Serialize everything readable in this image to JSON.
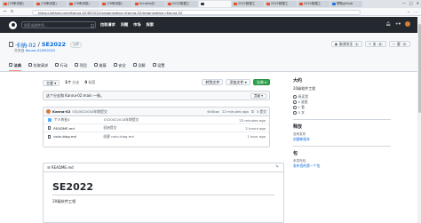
{
  "browser": {
    "tabs": [
      {
        "title": "(76条消息)",
        "icon": "csdn"
      },
      {
        "title": "(76条消息)",
        "icon": "csdn"
      },
      {
        "title": "(76条消息)",
        "icon": "csdn"
      },
      {
        "title": "(76条消息)",
        "icon": "csdn"
      },
      {
        "title": "Scratch创",
        "icon": "csdn"
      },
      {
        "title": "2022数据工",
        "icon": "csdn"
      },
      {
        "title": "",
        "icon": "github",
        "active": true
      },
      {
        "title": "2022数据工",
        "icon": "csdn"
      },
      {
        "title": "2022数据工",
        "icon": "csdn"
      },
      {
        "title": "2022数据工",
        "icon": "csdn"
      },
      {
        "title": "帮助github",
        "icon": "baidu"
      }
    ],
    "url": "https://github.com/Kanna-02/SE2022/organization=Kanna-02/organization=Kanna-02",
    "window_controls": [
      "—",
      "□",
      "✕"
    ]
  },
  "github_header": {
    "search_placeholder": "搜索或跳转到...",
    "search_shortcut": "/",
    "nav": [
      "拉取请求",
      "问题",
      "市场",
      "探索"
    ],
    "right_icons": [
      "bell-icon",
      "plus-icon",
      "avatar"
    ]
  },
  "repo": {
    "owner": "卡纳-02",
    "separator": "/",
    "name": "SE2022",
    "visibility": "公开",
    "forked_from_prefix": "分叉自",
    "forked_from": "Kanna-02/SE2022",
    "actions": [
      {
        "label": "取消关注",
        "count": "1"
      },
      {
        "label": "叉",
        "count": "0"
      },
      {
        "label": "星",
        "count": "0"
      }
    ],
    "tabs": [
      {
        "label": "法典",
        "active": true
      },
      {
        "label": "拉取请求",
        "active": false
      },
      {
        "label": "行动",
        "active": false
      },
      {
        "label": "项目",
        "active": false
      },
      {
        "label": "维基",
        "active": false
      },
      {
        "label": "安全",
        "active": false
      },
      {
        "label": "见解",
        "active": false
      },
      {
        "label": "设置",
        "active": false
      }
    ]
  },
  "branchbar": {
    "branch": "主要 ▾",
    "branch_count_prefix": "1个",
    "branch_label": "分支",
    "tag_count_prefix": "0",
    "tag_label": "标签",
    "goto_file": "转到文件",
    "add_file": "添加文件 ▾",
    "code": "法典 ▾"
  },
  "ahead": {
    "message": "这个分支和 Kanna-02:main 一致。",
    "contribute": "贡献 ▾"
  },
  "commit": {
    "author": "Kanna-02",
    "message": "0320022018年期提交",
    "hash": "6c5bac",
    "time": "22 minutes ago",
    "history": "3 提交"
  },
  "files": [
    {
      "type": "dir",
      "name": "个人作业2",
      "message": "0320022018年期提交",
      "time": "22 minutes ago"
    },
    {
      "type": "file",
      "name": "README.md",
      "message": "初始提交",
      "time": "2 hours ago"
    },
    {
      "type": "file",
      "name": "csdn-blog.md",
      "message": "创建 csdn-blog.md",
      "time": "1 hour ago"
    }
  ],
  "readme": {
    "filename": "README.md",
    "title": "SE2022",
    "description": "20级软件工程"
  },
  "sidebar": {
    "about_title": "大约",
    "about_desc": "20级软件工程",
    "stats": [
      "阅读我",
      "0 星星",
      "1 看",
      "0 叉"
    ],
    "releases_title": "释放",
    "releases_none": "没有发布",
    "releases_link": "创建新版本",
    "packages_title": "包",
    "packages_none": "未发布包",
    "packages_link": "发布您的第一个包"
  }
}
